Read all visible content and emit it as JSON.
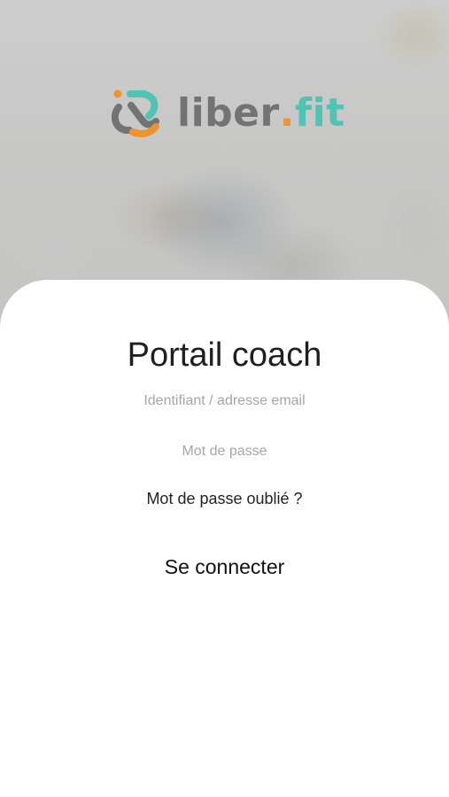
{
  "brand": {
    "logo_part1": "liber",
    "logo_dot": ".",
    "logo_part2": "fit",
    "colors": {
      "grey": "#737373",
      "orange": "#f0922e",
      "teal": "#4fc3b4"
    }
  },
  "login": {
    "title": "Portail coach",
    "identifier_placeholder": "Identifiant / adresse email",
    "identifier_value": "",
    "password_placeholder": "Mot de passe",
    "password_value": "",
    "forgot_label": "Mot de passe oublié ?",
    "connect_label": "Se connecter"
  }
}
